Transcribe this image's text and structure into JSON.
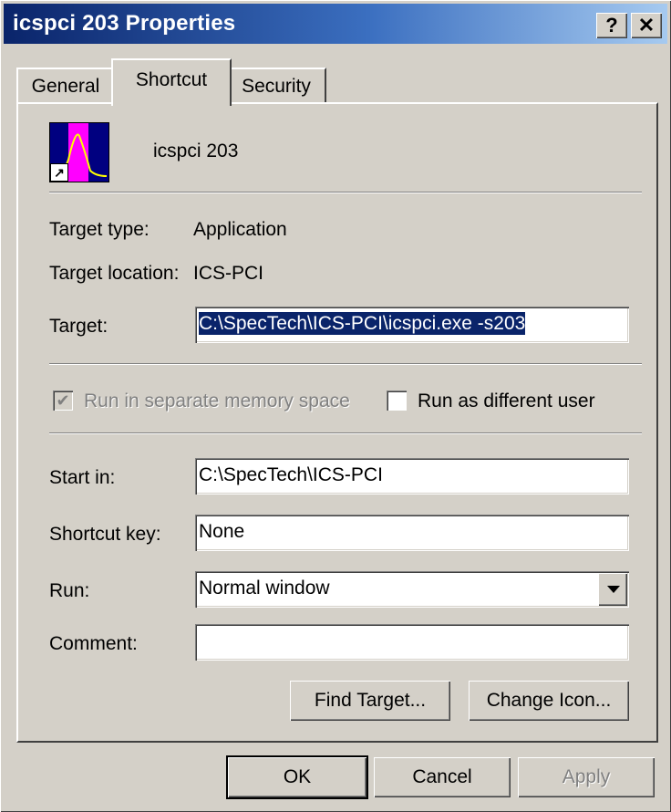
{
  "window": {
    "title": "icspci 203 Properties",
    "help_label": "?",
    "close_label": "✕"
  },
  "tabs": [
    {
      "label": "General",
      "active": false
    },
    {
      "label": "Shortcut",
      "active": true
    },
    {
      "label": "Security",
      "active": false
    }
  ],
  "shortcut": {
    "name": "icspci 203",
    "icon": "waveform-app-icon",
    "target_type_label": "Target type:",
    "target_type_value": "Application",
    "target_location_label": "Target location:",
    "target_location_value": "ICS-PCI",
    "target_label": "Target:",
    "target_value": "C:\\SpecTech\\ICS-PCI\\icspci.exe -s203",
    "run_separate_label": "Run in separate memory space",
    "run_separate_checked": true,
    "run_as_label": "Run as different user",
    "run_as_checked": false,
    "start_in_label": "Start in:",
    "start_in_value": "C:\\SpecTech\\ICS-PCI",
    "shortcut_key_label": "Shortcut key:",
    "shortcut_key_value": "None",
    "run_label": "Run:",
    "run_value": "Normal window",
    "comment_label": "Comment:",
    "comment_value": "",
    "find_target_label": "Find Target...",
    "change_icon_label": "Change Icon..."
  },
  "buttons": {
    "ok": "OK",
    "cancel": "Cancel",
    "apply": "Apply"
  },
  "colors": {
    "titlebar_start": "#0a246a",
    "titlebar_end": "#a6caf0",
    "face": "#d4d0c8",
    "selection": "#0a246a"
  }
}
